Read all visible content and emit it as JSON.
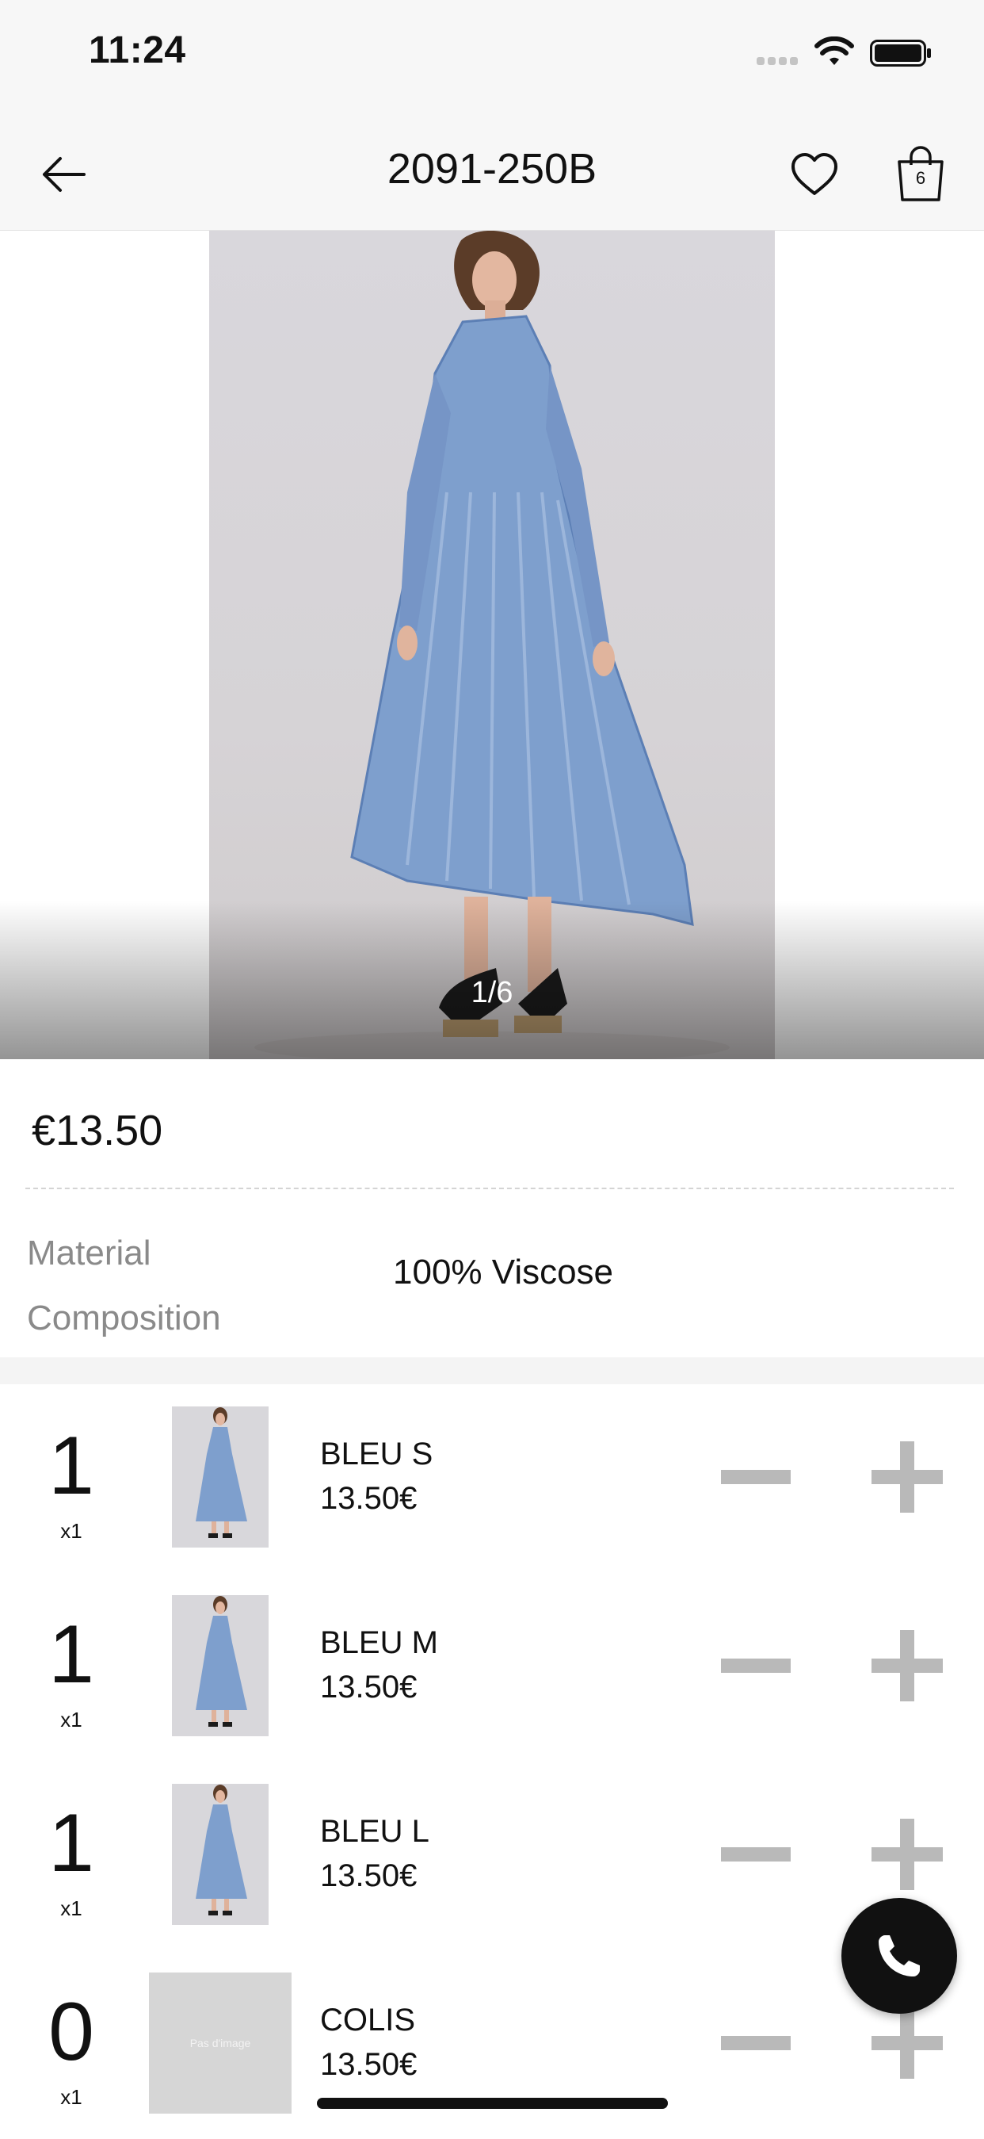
{
  "status_bar": {
    "time": "11:24"
  },
  "nav": {
    "title": "2091-250B",
    "cart_count": "6"
  },
  "image": {
    "counter": "1/6"
  },
  "product": {
    "price": "€13.50",
    "material_label": "Material Composition",
    "material_value": "100% Viscose"
  },
  "variants": [
    {
      "qty": "1",
      "multiplier": "x1",
      "name": "BLEU S",
      "price": "13.50€",
      "has_image": true
    },
    {
      "qty": "1",
      "multiplier": "x1",
      "name": "BLEU M",
      "price": "13.50€",
      "has_image": true
    },
    {
      "qty": "1",
      "multiplier": "x1",
      "name": "BLEU L",
      "price": "13.50€",
      "has_image": true
    },
    {
      "qty": "0",
      "multiplier": "x1",
      "name": "COLIS",
      "price": "13.50€",
      "has_image": false,
      "placeholder": "Pas d'image"
    }
  ],
  "icons": {
    "back": "arrow-left-icon",
    "favorite": "heart-icon",
    "cart": "shopping-bag-icon",
    "call": "phone-icon",
    "minus": "minus-icon",
    "plus": "plus-icon"
  },
  "colors": {
    "header_bg": "#f7f7f7",
    "control_gray": "#b9b9b9",
    "fab_bg": "#111111",
    "dress_blue": "#7e9fcd"
  }
}
